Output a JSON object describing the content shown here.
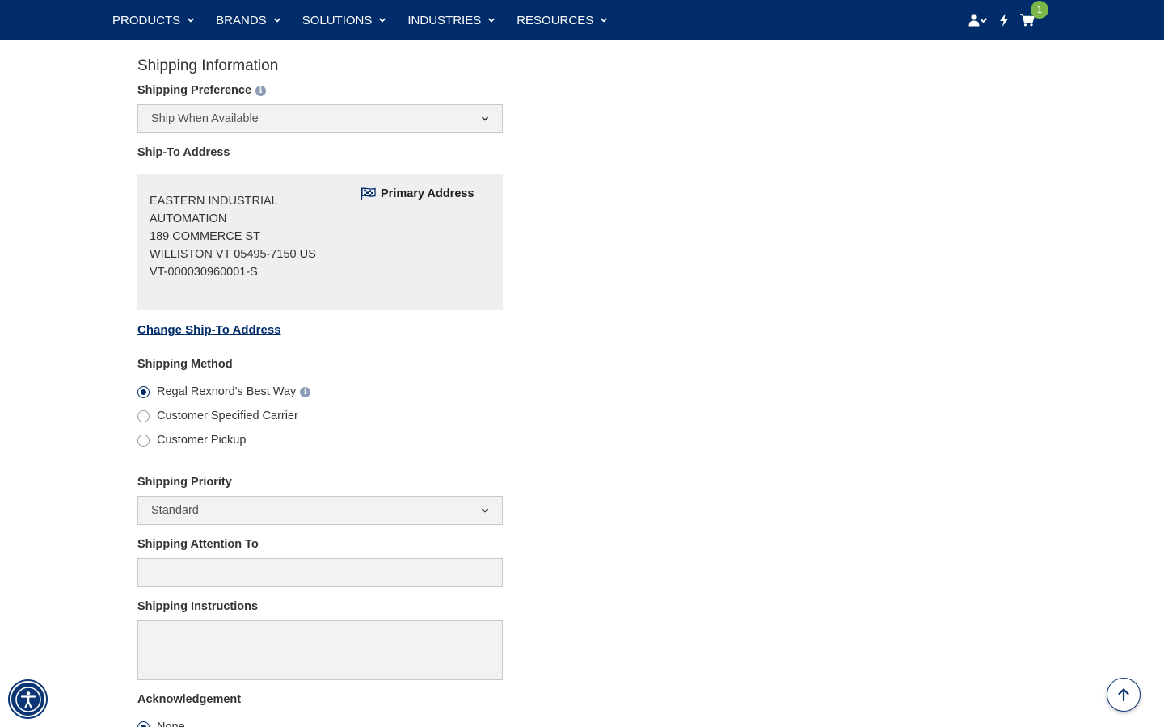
{
  "nav": {
    "items": [
      {
        "label": "PRODUCTS"
      },
      {
        "label": "BRANDS"
      },
      {
        "label": "SOLUTIONS"
      },
      {
        "label": "INDUSTRIES"
      },
      {
        "label": "RESOURCES"
      }
    ],
    "cart_count": "1"
  },
  "form": {
    "section_title": "Shipping Information",
    "shipping_preference": {
      "label": "Shipping Preference",
      "value": "Ship When Available"
    },
    "ship_to": {
      "label": "Ship-To Address",
      "address_lines": [
        "EASTERN INDUSTRIAL AUTOMATION",
        "189 COMMERCE ST",
        "WILLISTON VT 05495-7150 US",
        "VT-000030960001-S"
      ],
      "primary_label": "Primary Address",
      "change_link": "Change Ship-To Address"
    },
    "shipping_method": {
      "label": "Shipping Method",
      "options": [
        {
          "label": "Regal Rexnord's Best Way",
          "checked": true
        },
        {
          "label": "Customer Specified Carrier",
          "checked": false
        },
        {
          "label": "Customer Pickup",
          "checked": false
        }
      ]
    },
    "shipping_priority": {
      "label": "Shipping Priority",
      "value": "Standard"
    },
    "attention_to": {
      "label": "Shipping Attention To",
      "value": ""
    },
    "instructions": {
      "label": "Shipping Instructions",
      "value": ""
    },
    "acknowledgement": {
      "label": "Acknowledgement",
      "first_option": "None"
    }
  },
  "colors": {
    "navbar": "#002d6a",
    "badge": "#7ab648",
    "link": "#002d6a"
  },
  "icons": {
    "user": "user-check-icon",
    "quick": "bolt-icon",
    "cart": "cart-icon",
    "accessibility": "accessibility-icon",
    "back_to_top": "arrow-up-icon"
  }
}
